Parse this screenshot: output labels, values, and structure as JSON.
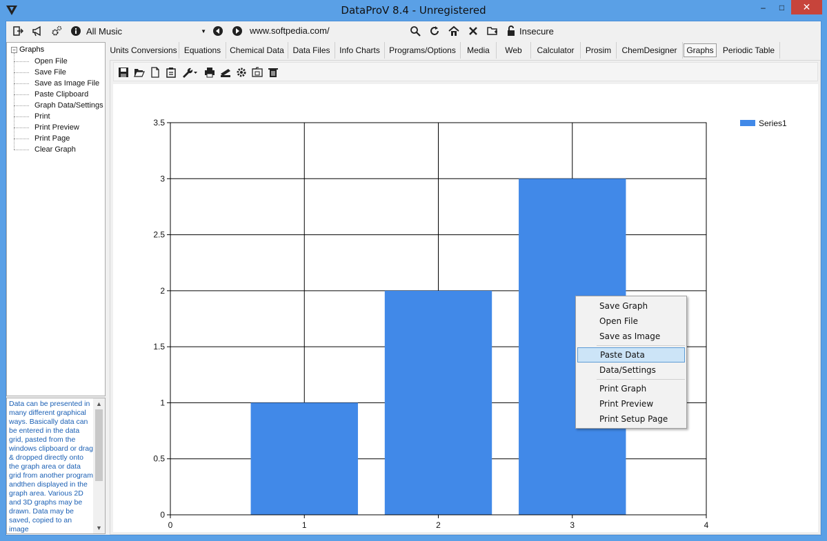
{
  "window": {
    "title": "DataProV 8.4 - Unregistered",
    "minimize": "–",
    "maximize": "□",
    "close": "✕"
  },
  "toolbar": {
    "combo_value": "All Music",
    "url": "www.softpedia.com/",
    "security": "Insecure",
    "icons": [
      "exit-icon",
      "megaphone-icon",
      "gears-icon",
      "info-icon",
      "back-icon",
      "forward-icon",
      "search-icon",
      "refresh-icon",
      "home-icon",
      "stop-icon",
      "folder-add-icon",
      "lock-icon"
    ]
  },
  "tree": {
    "root": "Graphs",
    "items": [
      "Open File",
      "Save File",
      "Save as Image File",
      "Paste Clipboard",
      "Graph Data/Settings",
      "Print",
      "Print Preview",
      "Print Page",
      "Clear Graph"
    ]
  },
  "help_text": "Data can be presented in many different graphical ways. Basically data can be entered in the data grid, pasted from the windows clipboard or drag & dropped directly onto the graph area or data grid from another program andthen displayed in the graph area. Various 2D and 3D graphs may be drawn. Data may be saved, copied to an image",
  "tabs": [
    "Units Conversions",
    "Equations",
    "Chemical Data",
    "Data Files",
    "Info Charts",
    "Programs/Options",
    "Media",
    "Web",
    "Calculator",
    "Prosim",
    "ChemDesigner",
    "Graphs",
    "Periodic Table"
  ],
  "active_tab": "Graphs",
  "graph_toolbar": {
    "icons": [
      "save-icon",
      "open-folder-icon",
      "new-file-icon",
      "clipboard-icon",
      "wrench-icon",
      "printer-icon",
      "scanner-icon",
      "gear-icon",
      "image-file-icon",
      "trash-icon"
    ]
  },
  "colors": {
    "bar": "#4189e8",
    "accent": "#5aa0e6"
  },
  "chart_data": {
    "type": "bar",
    "x": [
      1,
      2,
      3
    ],
    "series": [
      {
        "name": "Series1",
        "values": [
          1,
          2,
          3
        ]
      }
    ],
    "xlim": [
      0,
      4
    ],
    "ylim": [
      0,
      3.5
    ],
    "x_ticks": [
      "0",
      "1",
      "2",
      "3",
      "4"
    ],
    "y_ticks": [
      "0",
      "0.5",
      "1",
      "1.5",
      "2",
      "2.5",
      "3",
      "3.5"
    ],
    "grid": true,
    "legend": "top-right"
  },
  "context_menu": {
    "items": [
      "Save Graph",
      "Open File",
      "Save as Image",
      "Paste Data",
      "Data/Settings",
      "Print Graph",
      "Print Preview",
      "Print Setup Page"
    ],
    "highlighted": "Paste Data"
  }
}
